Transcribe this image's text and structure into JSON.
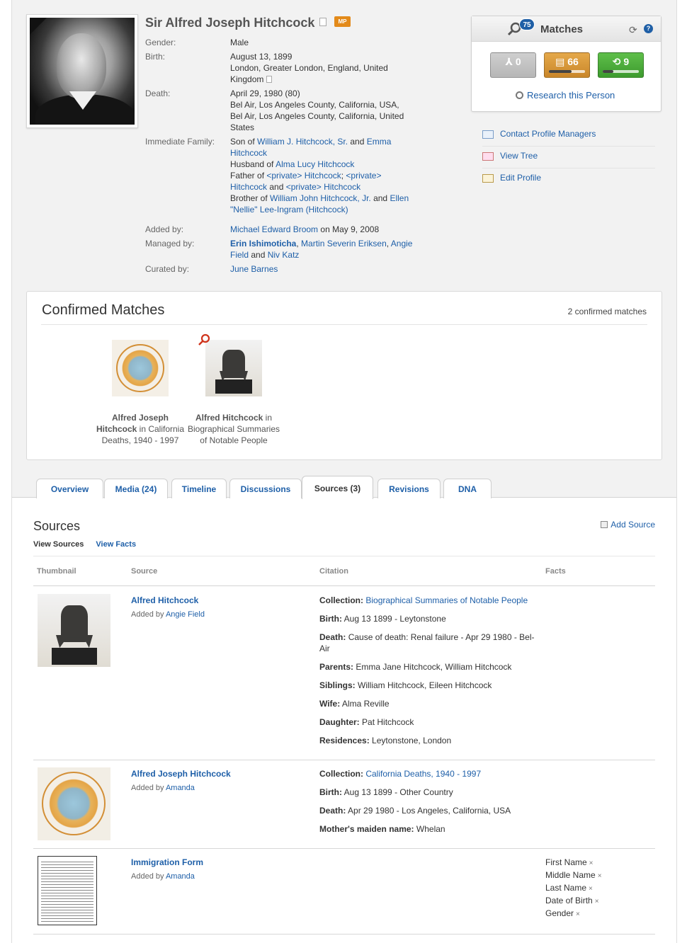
{
  "profile": {
    "name": "Sir Alfred Joseph Hitchcock",
    "badge": "MP",
    "facts": {
      "gender_label": "Gender:",
      "gender": "Male",
      "birth_label": "Birth:",
      "birth_date": "August 13, 1899",
      "birth_place": "London, Greater London, England, United Kingdom",
      "death_label": "Death:",
      "death_date": "April 29, 1980 (80)",
      "death_place1": "Bel Air, Los Angeles County, California, USA,",
      "death_place2": "Bel Air, Los Angeles County, California, United States",
      "family_label": "Immediate Family:",
      "son_of_prefix": "Son of ",
      "father": "William J. Hitchcock, Sr.",
      "and": " and ",
      "mother": "Emma Hitchcock",
      "husband_prefix": "Husband of ",
      "wife": "Alma Lucy Hitchcock",
      "father_of_prefix": "Father of ",
      "child1": "<private> Hitchcock",
      "sep": "; ",
      "child2": "<private> Hitchcock",
      "child3": "<private> Hitchcock",
      "brother_prefix": "Brother of ",
      "brother": "William John Hitchcock, Jr.",
      "sister": "Ellen \"Nellie\" Lee-Ingram (Hitchcock)",
      "added_label": "Added by:",
      "added_by": "Michael Edward Broom",
      "added_on": " on May 9, 2008",
      "managed_label": "Managed by:",
      "manager1": "Erin Ishimoticha",
      "comma": ", ",
      "manager2": "Martin Severin Eriksen",
      "manager3": "Angie Field",
      "manager4": "Niv Katz",
      "curated_label": "Curated by:",
      "curator": "June Barnes"
    }
  },
  "matches": {
    "count": "75",
    "title": "Matches",
    "tree_matches": "0",
    "record_matches": "66",
    "smart_matches": "9",
    "record_progress": 0.62,
    "smart_progress": 0.3,
    "research_link": "Research this Person"
  },
  "actions": [
    {
      "label": "Contact Profile Managers"
    },
    {
      "label": "View Tree"
    },
    {
      "label": "Edit Profile"
    }
  ],
  "confirmed": {
    "title": "Confirmed Matches",
    "count_text": "2 confirmed matches",
    "items": [
      {
        "name": "Alfred Joseph Hitchcock",
        "in": " in California Deaths, 1940 - 1997"
      },
      {
        "name": "Alfred Hitchcock",
        "in": " in Biographical Summaries of Notable People"
      }
    ]
  },
  "tabs": [
    {
      "label": "Overview"
    },
    {
      "label": "Media (24)"
    },
    {
      "label": "Timeline"
    },
    {
      "label": "Discussions"
    },
    {
      "label": "Sources (3)"
    },
    {
      "label": "Revisions"
    },
    {
      "label": "DNA"
    }
  ],
  "sources": {
    "title": "Sources",
    "add_label": "Add Source",
    "view_sources": "View Sources",
    "view_facts": "View Facts",
    "columns": {
      "thumbnail": "Thumbnail",
      "source": "Source",
      "citation": "Citation",
      "facts": "Facts"
    },
    "added_by": "Added by ",
    "rows": [
      {
        "title": "Alfred Hitchcock",
        "added_by": "Angie Field",
        "citations": [
          {
            "label": "Collection:",
            "value": "Biographical Summaries of Notable People",
            "link": true
          },
          {
            "label": "Birth:",
            "value": "Aug 13 1899 - Leytonstone"
          },
          {
            "label": "Death:",
            "value": "Cause of death: Renal failure - Apr 29 1980 - Bel-Air"
          },
          {
            "label": "Parents:",
            "value": "Emma Jane Hitchcock, William Hitchcock"
          },
          {
            "label": "Siblings:",
            "value": "William Hitchcock, Eileen Hitchcock"
          },
          {
            "label": "Wife:",
            "value": "Alma Reville"
          },
          {
            "label": "Daughter:",
            "value": "Pat Hitchcock"
          },
          {
            "label": "Residences:",
            "value": "Leytonstone, London"
          }
        ]
      },
      {
        "title": "Alfred Joseph Hitchcock",
        "added_by": "Amanda",
        "citations": [
          {
            "label": "Collection:",
            "value": "California Deaths, 1940 - 1997",
            "link": true
          },
          {
            "label": "Birth:",
            "value": "Aug 13 1899 - Other Country"
          },
          {
            "label": "Death:",
            "value": "Apr 29 1980 - Los Angeles, California, USA"
          },
          {
            "label": "Mother's maiden name:",
            "value": "Whelan"
          }
        ]
      },
      {
        "title": "Immigration Form",
        "added_by": "Amanda",
        "facts": [
          "First Name",
          "Middle Name",
          "Last Name",
          "Date of Birth",
          "Gender"
        ]
      }
    ]
  },
  "icons": {
    "remove": "×",
    "refresh": "⟳",
    "help": "?"
  },
  "colors": {
    "link": "#1e5fa8",
    "badge": "#e38a1a",
    "bubble": "#1f5fa6",
    "gold": "#d6982f",
    "green": "#4cac3b"
  }
}
